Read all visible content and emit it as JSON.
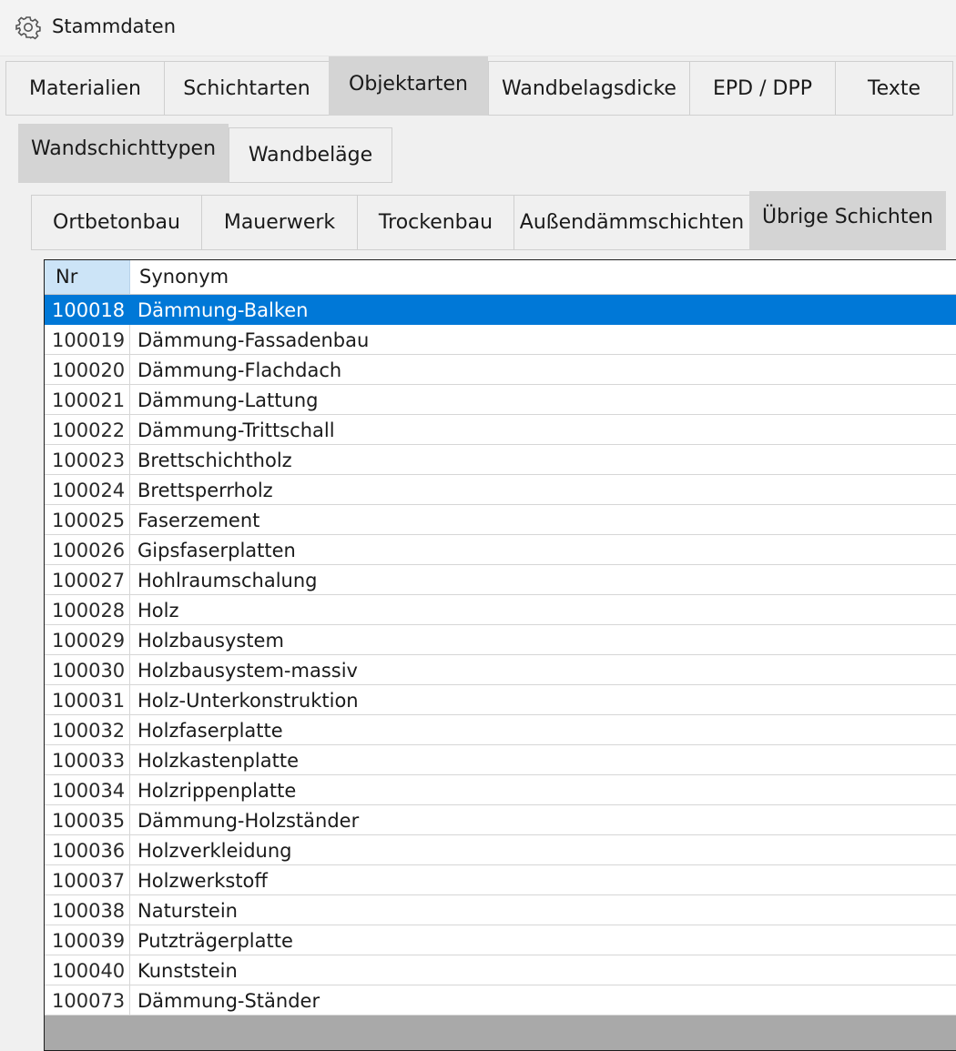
{
  "window": {
    "title": "Stammdaten",
    "icon": "gear-icon"
  },
  "tabs_main": [
    {
      "label": "Materialien",
      "active": false
    },
    {
      "label": "Schichtarten",
      "active": false
    },
    {
      "label": "Objektarten",
      "active": true
    },
    {
      "label": "Wandbelagsdicke",
      "active": false
    },
    {
      "label": "EPD / DPP",
      "active": false
    },
    {
      "label": "Texte",
      "active": false
    }
  ],
  "tabs_sub": [
    {
      "label": "Wandschichttypen",
      "active": true
    },
    {
      "label": "Wandbeläge",
      "active": false
    }
  ],
  "tabs_layer": [
    {
      "label": "Ortbetonbau",
      "active": false
    },
    {
      "label": "Mauerwerk",
      "active": false
    },
    {
      "label": "Trockenbau",
      "active": false
    },
    {
      "label": "Außendämmschichten",
      "active": false
    },
    {
      "label": "Übrige Schichten",
      "active": true
    }
  ],
  "grid": {
    "columns": [
      "Nr",
      "Synonym"
    ],
    "selected_color": "#0078d7",
    "header_highlight_color": "#cce4f7",
    "rows": [
      {
        "nr": "100018",
        "synonym": "Dämmung-Balken",
        "selected": true
      },
      {
        "nr": "100019",
        "synonym": "Dämmung-Fassadenbau"
      },
      {
        "nr": "100020",
        "synonym": "Dämmung-Flachdach"
      },
      {
        "nr": "100021",
        "synonym": "Dämmung-Lattung"
      },
      {
        "nr": "100022",
        "synonym": "Dämmung-Trittschall"
      },
      {
        "nr": "100023",
        "synonym": "Brettschichtholz"
      },
      {
        "nr": "100024",
        "synonym": "Brettsperrholz"
      },
      {
        "nr": "100025",
        "synonym": "Faserzement"
      },
      {
        "nr": "100026",
        "synonym": "Gipsfaserplatten"
      },
      {
        "nr": "100027",
        "synonym": "Hohlraumschalung"
      },
      {
        "nr": "100028",
        "synonym": "Holz"
      },
      {
        "nr": "100029",
        "synonym": "Holzbausystem"
      },
      {
        "nr": "100030",
        "synonym": "Holzbausystem-massiv"
      },
      {
        "nr": "100031",
        "synonym": "Holz-Unterkonstruktion"
      },
      {
        "nr": "100032",
        "synonym": "Holzfaserplatte"
      },
      {
        "nr": "100033",
        "synonym": "Holzkastenplatte"
      },
      {
        "nr": "100034",
        "synonym": "Holzrippenplatte"
      },
      {
        "nr": "100035",
        "synonym": "Dämmung-Holzständer"
      },
      {
        "nr": "100036",
        "synonym": "Holzverkleidung"
      },
      {
        "nr": "100037",
        "synonym": "Holzwerkstoff"
      },
      {
        "nr": "100038",
        "synonym": "Naturstein"
      },
      {
        "nr": "100039",
        "synonym": "Putzträgerplatte"
      },
      {
        "nr": "100040",
        "synonym": "Kunststein"
      },
      {
        "nr": "100073",
        "synonym": "Dämmung-Ständer"
      }
    ]
  }
}
